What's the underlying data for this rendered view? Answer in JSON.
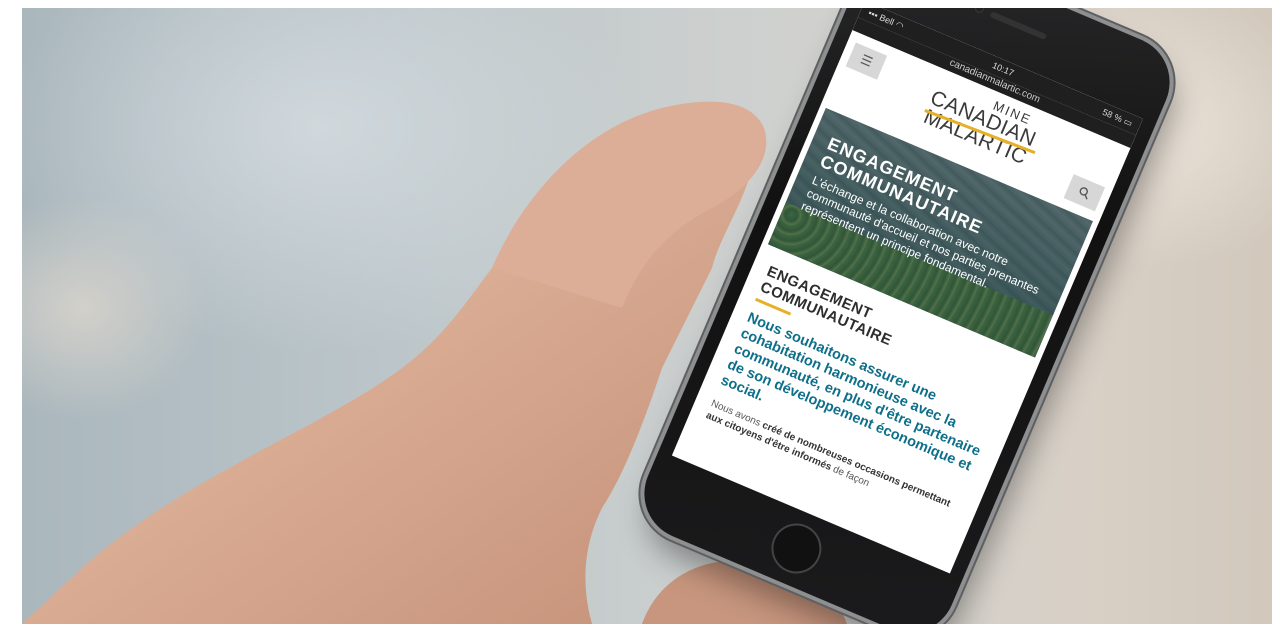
{
  "status_bar": {
    "carrier": "Bell",
    "time": "10:17",
    "battery": "58 %"
  },
  "browser": {
    "url": "canadianmalartic.com"
  },
  "logo": {
    "line1": "MINE",
    "line2": "CANADIAN",
    "line3": "MALARTIC"
  },
  "hero": {
    "title_line1": "ENGAGEMENT",
    "title_line2": "COMMUNAUTAIRE",
    "text": "L'échange et la collaboration avec notre communauté d'accueil et nos parties prenantes représentent un principe fondamental."
  },
  "section": {
    "title_line1": "ENGAGEMENT",
    "title_line2": "COMMUNAUTAIRE",
    "lead": "Nous souhaitons assurer une cohabitation harmonieuse avec la communauté, en plus d'être partenaire de son développement économique et social.",
    "body_start": "Nous avons ",
    "body_bold": "créé de nombreuses occasions permettant aux citoyens d'être informés",
    "body_end": " de façon"
  },
  "icons": {
    "menu": "menu-icon",
    "search": "search-icon",
    "wifi": "wifi-icon",
    "battery": "battery-icon"
  },
  "colors": {
    "accent_yellow": "#e6b128",
    "lead_blue": "#0e6f8a"
  }
}
